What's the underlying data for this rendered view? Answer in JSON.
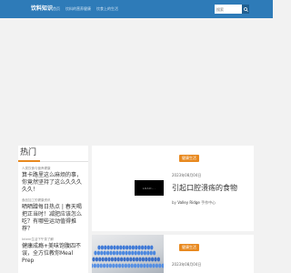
{
  "header": {
    "logo": "饮料知识",
    "nav": [
      "首页",
      "饮料的营养健康",
      "饮食上的生活"
    ],
    "search_placeholder": "搜索",
    "search_icon": "search-icon"
  },
  "sidebar": {
    "title": "热门",
    "items": [
      {
        "category": "人类饮食与营养健康",
        "title": "算卡路里这么麻烦的事，你竟然坚持了这么久久久久久！"
      },
      {
        "category": "食品加工的健康资讯",
        "title": "晒晒蹭每日热点 | 春天喝把正当时！减肥应该怎么吃？有哪些运动值得推荐？"
      },
      {
        "category": "Intern生活下午茶了解",
        "title": "健康成瘾+美味饱腹四不误，全方位教你Meal Prep"
      }
    ]
  },
  "posts": [
    {
      "badge": "健康生活",
      "date": "2023年08月04日",
      "title": "引起口腔溃疡的食物",
      "by": "by",
      "author": "Valley Ridge",
      "author_suffix": "手作中心",
      "thumb_text": "LOAD..."
    },
    {
      "badge": "健康生活",
      "date": "2023年08月04日"
    }
  ],
  "colors": {
    "topbar": "#2e7bb8",
    "accent": "#e8891f",
    "background": "#f2f2f2"
  }
}
